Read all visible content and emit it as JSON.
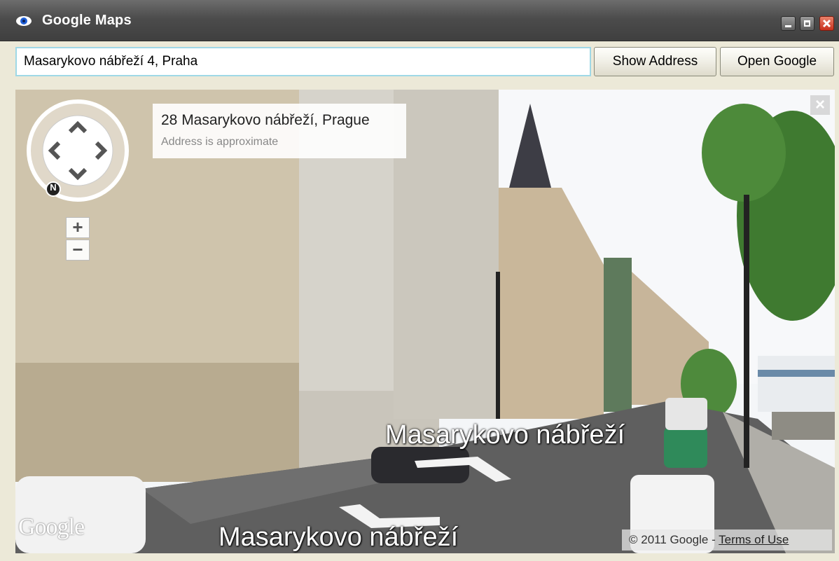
{
  "window": {
    "title": "Google Maps",
    "icon": "eye-icon",
    "controls": [
      "minimize",
      "maximize",
      "close"
    ]
  },
  "toolbar": {
    "address_value": "Masarykovo nábřeží 4, Praha",
    "show_address_label": "Show Address",
    "open_google_label": "Open Google"
  },
  "streetview": {
    "info_title": "28 Masarykovo nábřeží, Prague",
    "info_subtitle": "Address is approximate",
    "close_label": "×",
    "compass_north": "N",
    "zoom_in_label": "+",
    "zoom_out_label": "−",
    "street_label_far": "Masarykovo nábřeží",
    "street_label_near": "Masarykovo nábřeží",
    "logo_text": "Google",
    "copyright_text": "© 2011 Google - ",
    "terms_label": "Terms of Use"
  }
}
